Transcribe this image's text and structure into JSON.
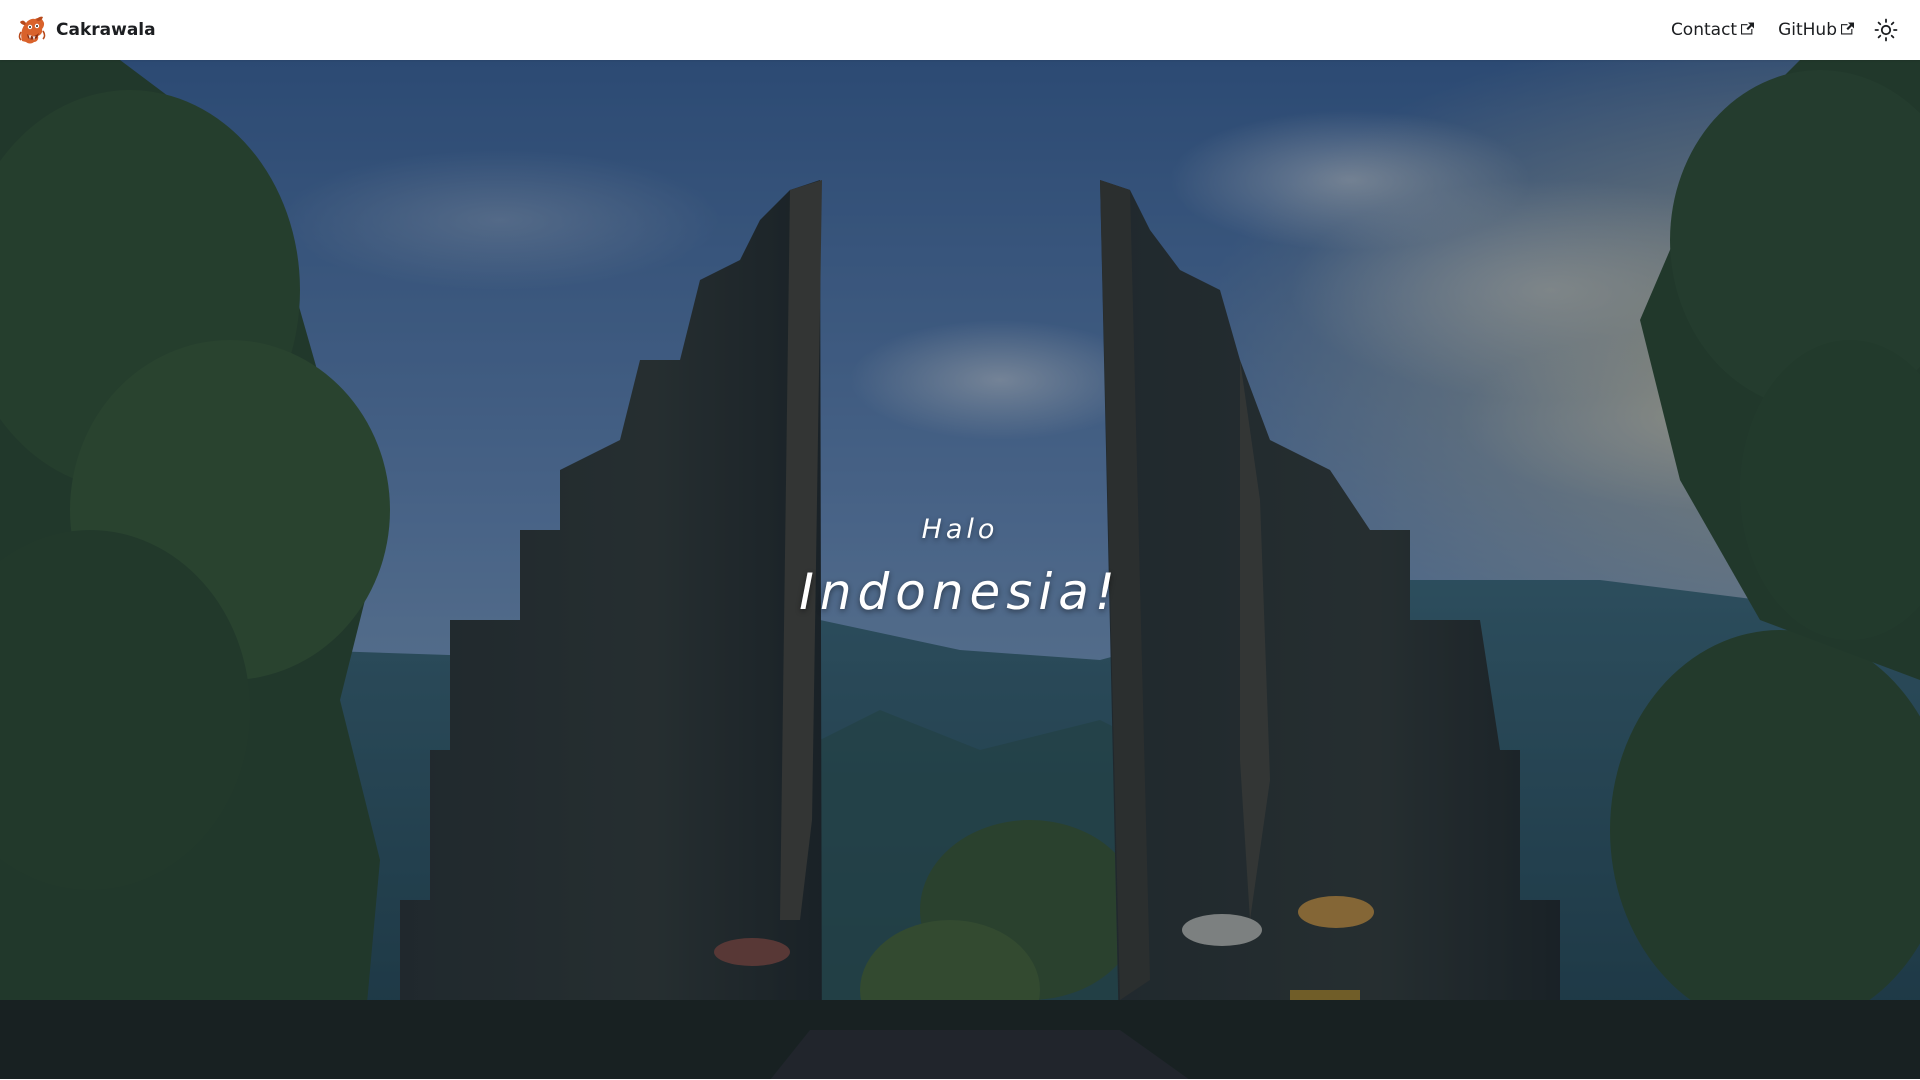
{
  "navbar": {
    "brand_title": "Cakrawala",
    "brand_logo_icon": "barong-mask-logo",
    "links": [
      {
        "label": "Contact",
        "icon": "external-link-icon"
      },
      {
        "label": "GitHub",
        "icon": "external-link-icon"
      }
    ],
    "theme_toggle_icon": "sun-icon"
  },
  "hero": {
    "kicker": "Halo",
    "title": "Indonesia!",
    "background_image": "Bali split gate (candi bentar) with mountains and blue sky"
  },
  "colors": {
    "text": "#1c1e21",
    "hero_text": "#ffffff",
    "brand_logo": "#d9622b"
  }
}
